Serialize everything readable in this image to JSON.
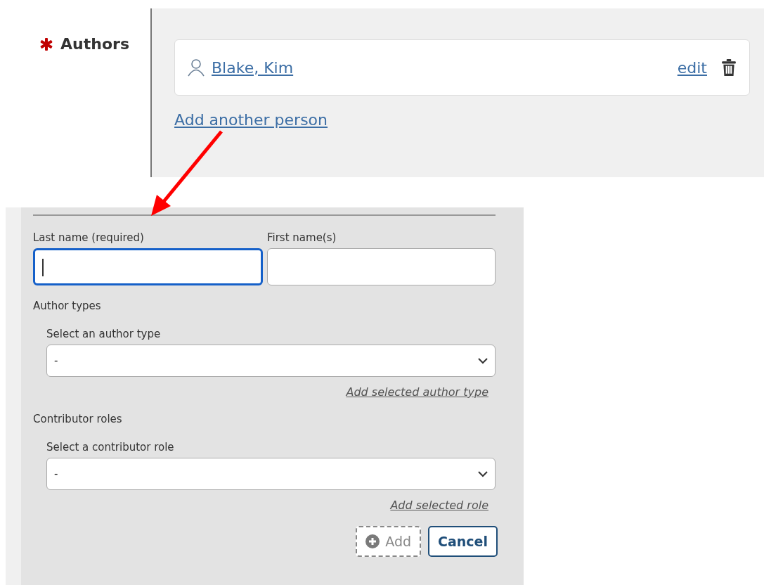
{
  "authors_field": {
    "label": "Authors",
    "required": true,
    "people": [
      {
        "name": "Blake, Kim",
        "edit_link": "edit"
      }
    ],
    "add_link": "Add another person"
  },
  "person_form": {
    "last_name": {
      "label": "Last name (required)",
      "focused": true
    },
    "first_name": {
      "label": "First name(s)",
      "focused": false
    },
    "sections": [
      {
        "heading": "Author types",
        "select_label": "Select an author type",
        "value": "-",
        "add_link": "Add selected author type"
      },
      {
        "heading": "Contributor roles",
        "select_label": "Select a contributor role",
        "value": "-",
        "add_link": "Add selected role"
      }
    ],
    "buttons": [
      {
        "label": "Add",
        "kind": "add",
        "disabled": true
      },
      {
        "label": "Cancel",
        "kind": "cancel",
        "disabled": false
      }
    ]
  }
}
